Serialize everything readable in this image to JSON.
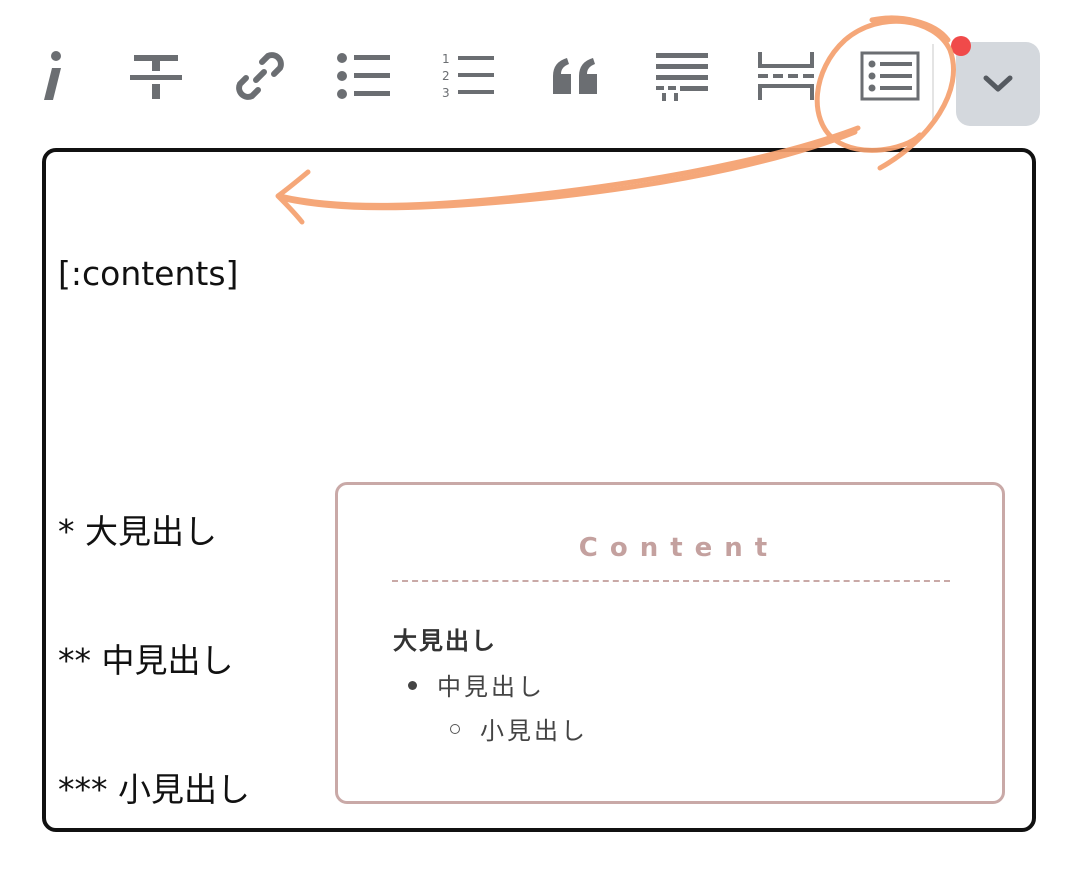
{
  "toolbar": {
    "buttons": [
      {
        "name": "italic",
        "icon": "italic-icon"
      },
      {
        "name": "strikethrough",
        "icon": "strikethrough-icon"
      },
      {
        "name": "link",
        "icon": "link-icon"
      },
      {
        "name": "bulleted-list",
        "icon": "bulleted-list-icon"
      },
      {
        "name": "numbered-list",
        "icon": "numbered-list-icon",
        "numbers": [
          "1",
          "2",
          "3"
        ]
      },
      {
        "name": "quote",
        "icon": "quote-icon"
      },
      {
        "name": "more-text",
        "icon": "read-more-icon"
      },
      {
        "name": "page-break",
        "icon": "page-break-icon"
      },
      {
        "name": "table-of-contents",
        "icon": "table-of-contents-icon"
      }
    ],
    "more_button_icon": "chevron-down-icon",
    "notification_color": "#f04a4a"
  },
  "editor": {
    "lines": [
      "[:contents]",
      "",
      "* 大見出し",
      "** 中見出し",
      "*** 小見出し"
    ]
  },
  "preview": {
    "title": "Content",
    "h1": "大見出し",
    "h2": "中見出し",
    "h3": "小見出し",
    "accent_color": "#c9a9a7"
  },
  "annotation": {
    "color": "#f5a06e"
  }
}
